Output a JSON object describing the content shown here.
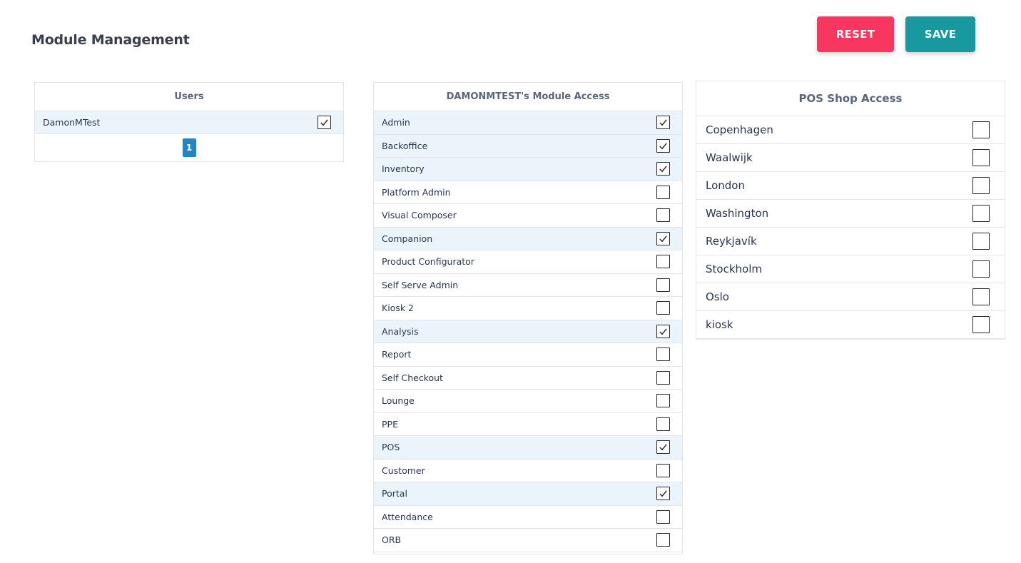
{
  "header": {
    "title": "Module Management",
    "reset_label": "RESET",
    "save_label": "SAVE"
  },
  "colors": {
    "reset": "#f9365f",
    "save": "#17999f",
    "selected_row": "#ebf4fb",
    "pager": "#2386c2"
  },
  "users": {
    "header": "Users",
    "rows": [
      {
        "name": "DamonMTest",
        "checked": true
      }
    ],
    "current_page": "1"
  },
  "modules": {
    "header": "DAMONMTEST's Module Access",
    "rows": [
      {
        "name": "Admin",
        "checked": true
      },
      {
        "name": "Backoffice",
        "checked": true
      },
      {
        "name": "Inventory",
        "checked": true
      },
      {
        "name": "Platform Admin",
        "checked": false
      },
      {
        "name": "Visual Composer",
        "checked": false
      },
      {
        "name": "Companion",
        "checked": true
      },
      {
        "name": "Product Configurator",
        "checked": false
      },
      {
        "name": "Self Serve Admin",
        "checked": false
      },
      {
        "name": "Kiosk 2",
        "checked": false
      },
      {
        "name": "Analysis",
        "checked": true
      },
      {
        "name": "Report",
        "checked": false
      },
      {
        "name": "Self Checkout",
        "checked": false
      },
      {
        "name": "Lounge",
        "checked": false
      },
      {
        "name": "PPE",
        "checked": false
      },
      {
        "name": "POS",
        "checked": true
      },
      {
        "name": "Customer",
        "checked": false
      },
      {
        "name": "Portal",
        "checked": true
      },
      {
        "name": "Attendance",
        "checked": false
      },
      {
        "name": "ORB",
        "checked": false
      }
    ]
  },
  "shops": {
    "header": "POS Shop Access",
    "rows": [
      {
        "name": "Copenhagen",
        "checked": false
      },
      {
        "name": "Waalwijk",
        "checked": false
      },
      {
        "name": "London",
        "checked": false
      },
      {
        "name": "Washington",
        "checked": false
      },
      {
        "name": "Reykjavík",
        "checked": false
      },
      {
        "name": "Stockholm",
        "checked": false
      },
      {
        "name": "Oslo",
        "checked": false
      },
      {
        "name": "kiosk",
        "checked": false
      }
    ]
  }
}
